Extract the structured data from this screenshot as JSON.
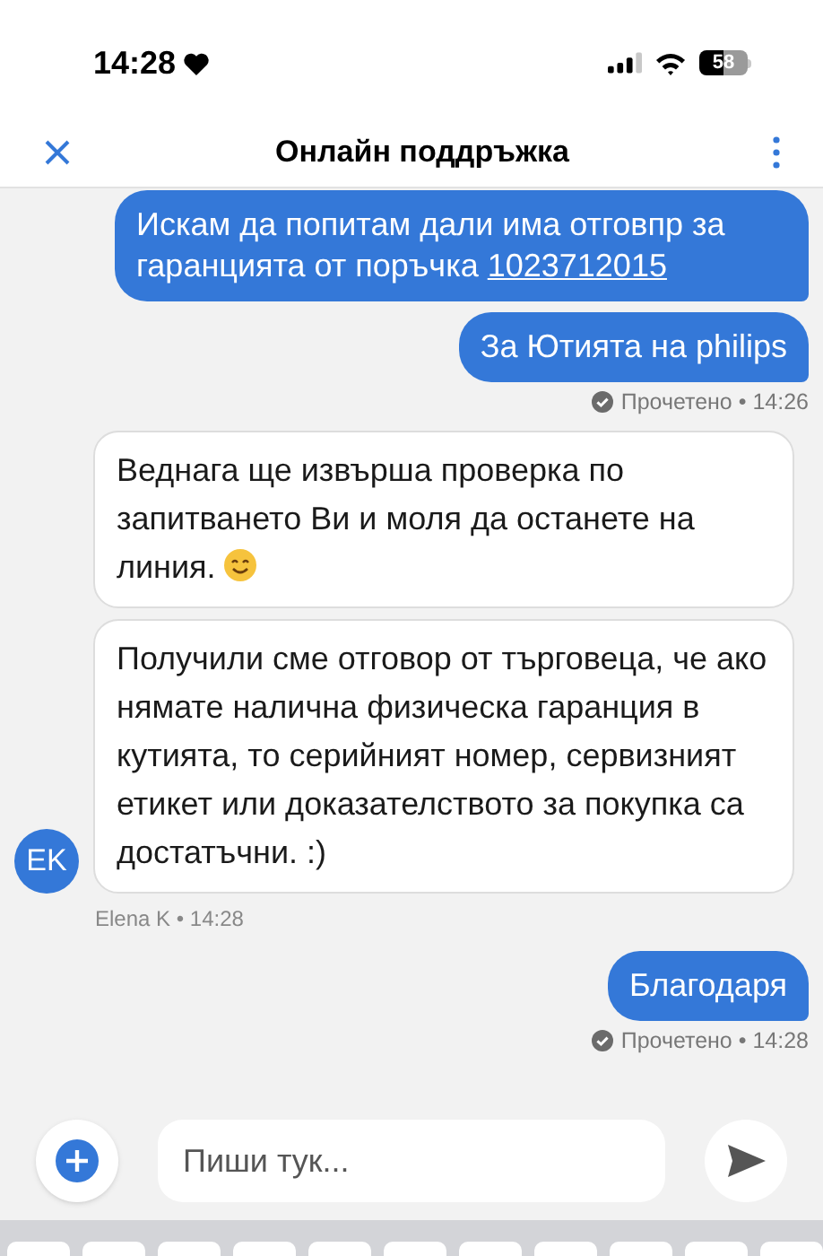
{
  "status_bar": {
    "time": "14:28",
    "battery": "58"
  },
  "header": {
    "title": "Онлайн поддръжка"
  },
  "messages": [
    {
      "kind": "out",
      "text": "Искам да попитам дали има отговпр за гаранцията от поръчка ",
      "link": "1023712015"
    },
    {
      "kind": "out",
      "text": "За Ютията на philips"
    },
    {
      "kind": "receipt",
      "text": "Прочетено • 14:26"
    },
    {
      "kind": "in",
      "text": "Веднага ще извърша проверка по запитването Ви и моля да останете на линия.",
      "smiley": true
    },
    {
      "kind": "in",
      "text": "Получили сме отговор от търговеца, че ако нямате налична физическа гаранция в кутията, то серийният номер, сервизният етикет или доказателството за покупка са достатъчни. :)",
      "avatar": "EK"
    },
    {
      "kind": "author",
      "text": "Elena K • 14:28"
    },
    {
      "kind": "out",
      "text": "Благодаря"
    },
    {
      "kind": "receipt",
      "text": "Прочетено • 14:28"
    }
  ],
  "composer": {
    "placeholder": "Пиши тук..."
  }
}
